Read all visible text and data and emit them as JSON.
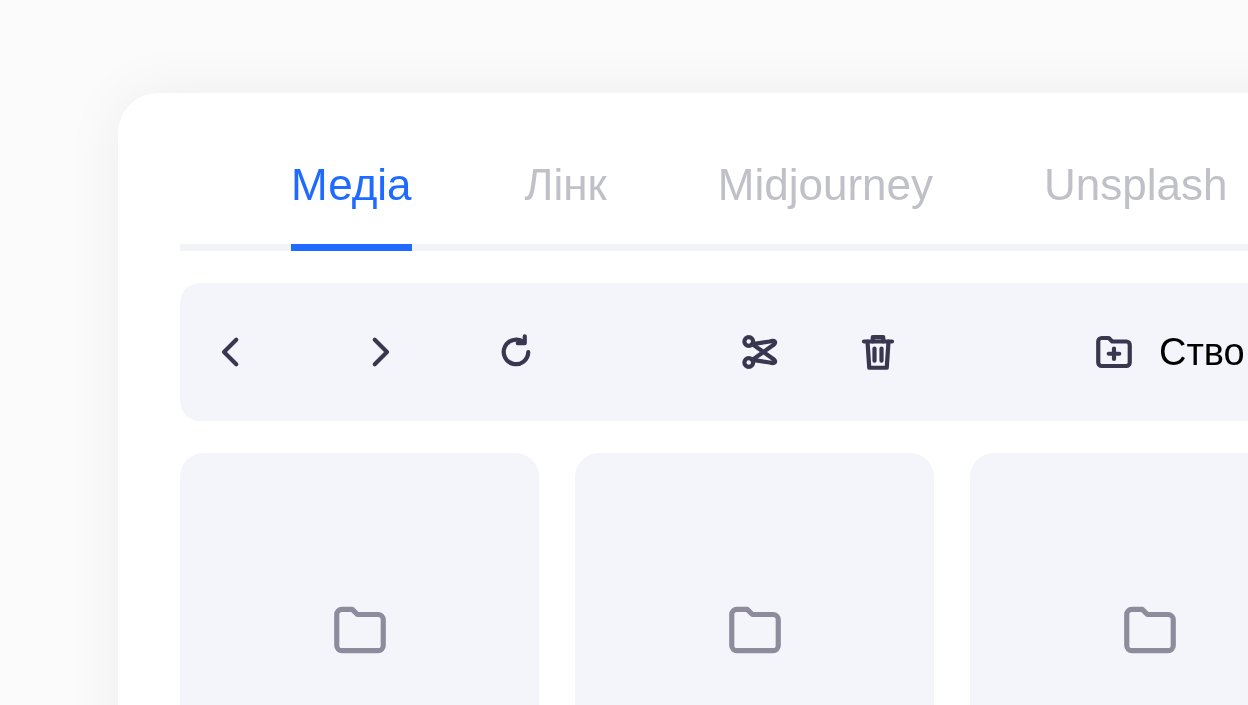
{
  "tabs": [
    {
      "label": "Медіа",
      "selected": true
    },
    {
      "label": "Лінк",
      "selected": false
    },
    {
      "label": "Midjourney",
      "selected": false
    },
    {
      "label": "Unsplash",
      "selected": false
    }
  ],
  "toolbar": [
    {
      "kind": "back"
    },
    {
      "kind": "forward"
    },
    {
      "kind": "refresh"
    },
    {
      "kind": "cut"
    },
    {
      "kind": "delete"
    },
    {
      "kind": "new-folder",
      "label": "Ство"
    }
  ],
  "tiles": [
    {
      "kind": "folder"
    },
    {
      "kind": "folder"
    },
    {
      "kind": "folder"
    }
  ]
}
